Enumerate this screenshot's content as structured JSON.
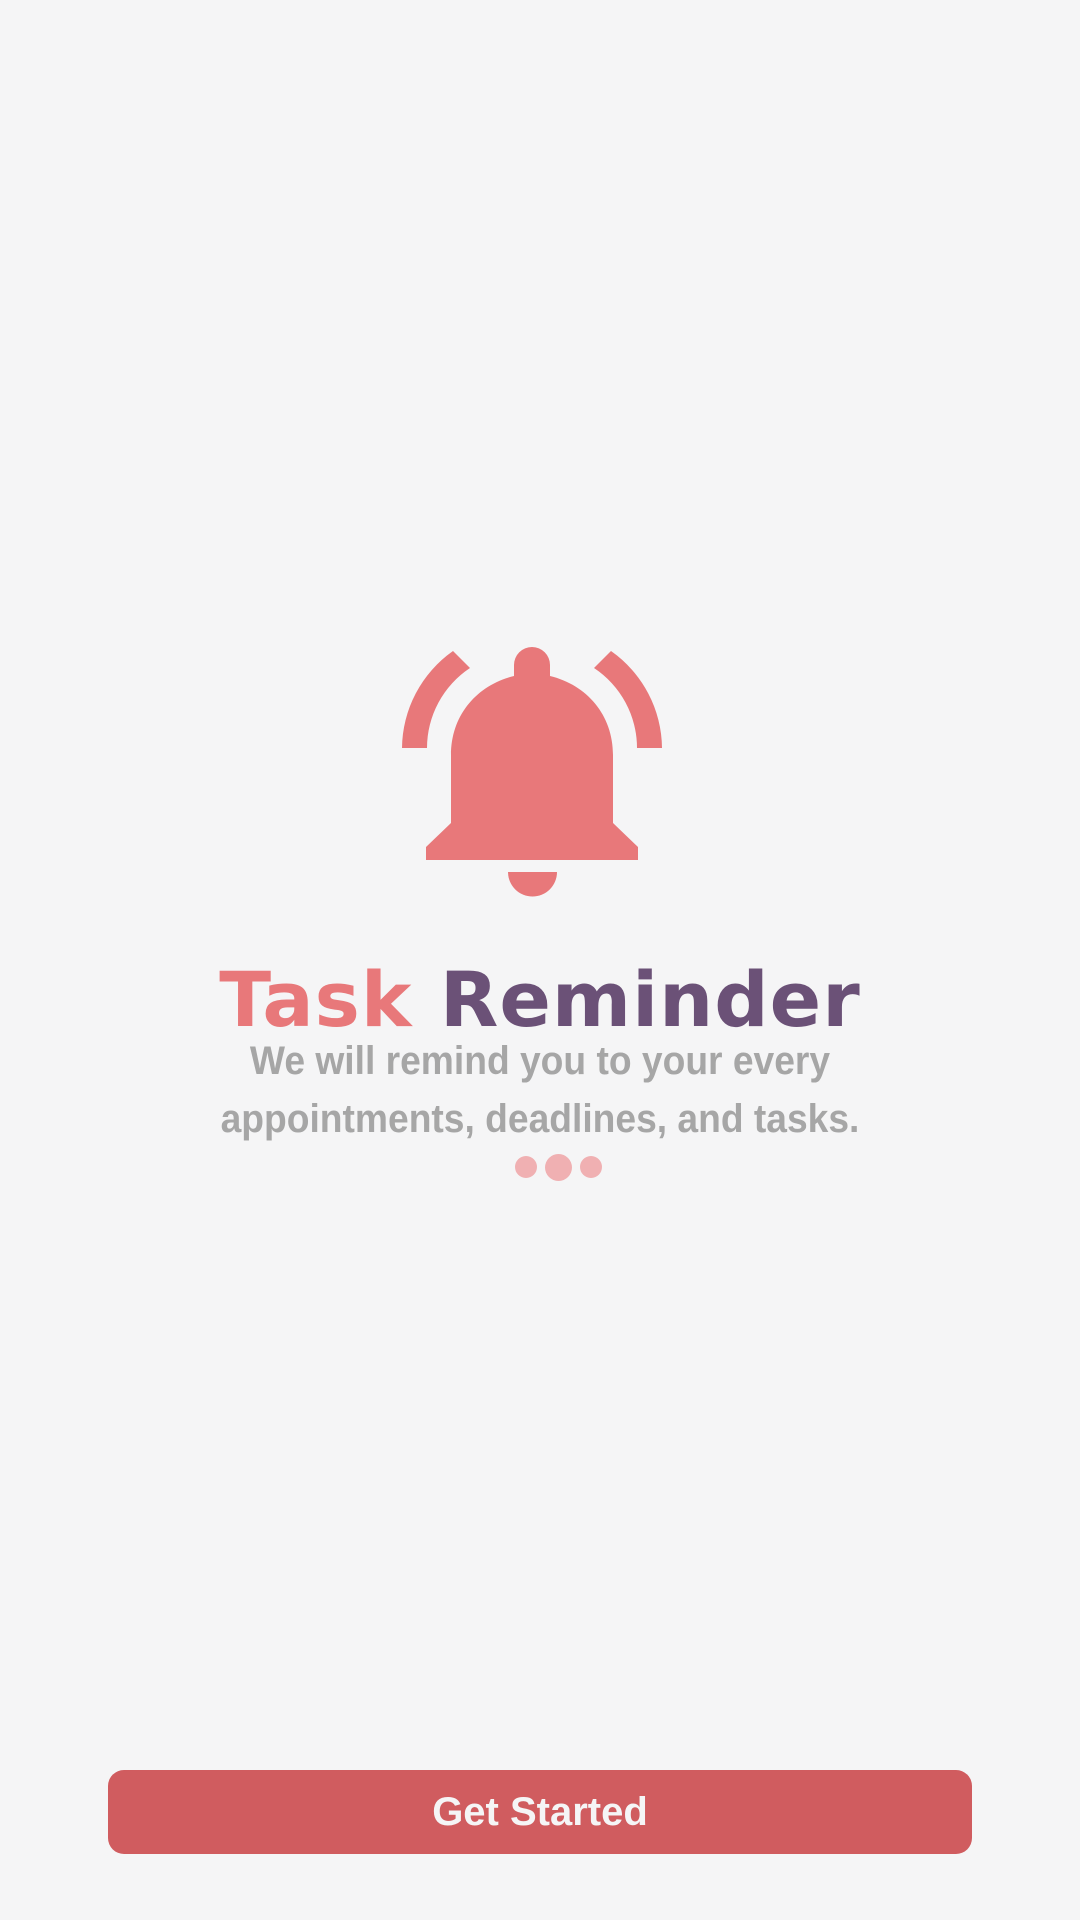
{
  "app": {
    "title_word_1": "Task",
    "title_word_2": "Reminder",
    "subtitle": "We will remind you to your every appointments, deadlines, and tasks."
  },
  "hero": {
    "icon": "bell-ringing-icon"
  },
  "pager": {
    "dot_count": 3,
    "active_index": 1
  },
  "cta": {
    "label": "Get Started"
  },
  "colors": {
    "background": "#f5f5f6",
    "accent": "#e8787a",
    "title_secondary": "#6b5177",
    "subtitle": "#a6a6a6",
    "button": "#d05c5f",
    "dots": "#f0b0b2"
  }
}
